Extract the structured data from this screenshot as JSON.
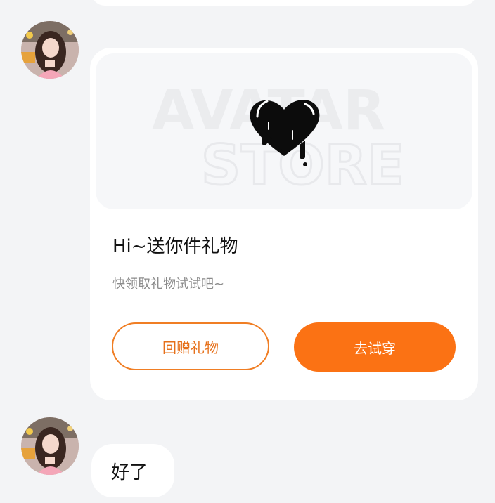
{
  "gift_card": {
    "banner_watermark_line1": "AVATAR",
    "banner_watermark_line2": "STORE",
    "title": "Hi~送你件礼物",
    "subtitle": "快领取礼物试试吧~",
    "return_gift_label": "回赠礼物",
    "try_on_label": "去试穿"
  },
  "message": {
    "text": "好了"
  },
  "colors": {
    "accent": "#fb7214",
    "outline_accent": "#f07e24",
    "background": "#f3f4f6",
    "card": "#ffffff"
  },
  "icons": {
    "gift_item": "heart-icon",
    "sender": "avatar"
  }
}
